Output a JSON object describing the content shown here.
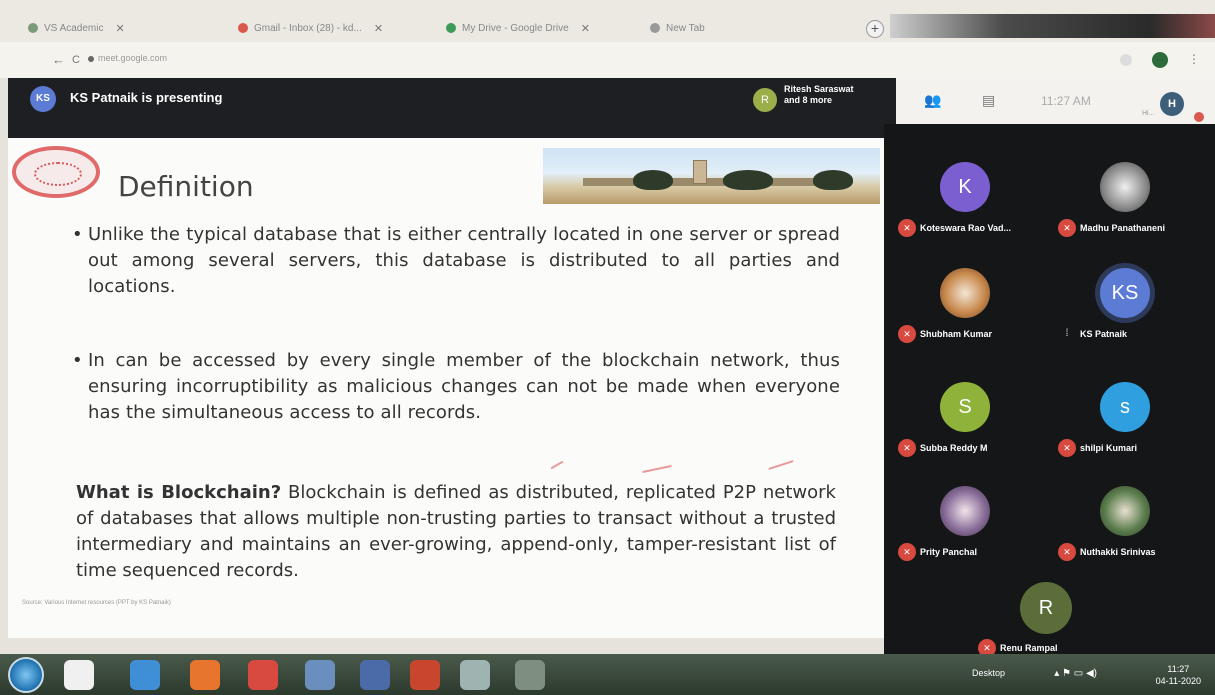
{
  "browser": {
    "tabs": [
      {
        "label": "VS Academic"
      },
      {
        "label": "Gmail - Inbox (28) - kd..."
      },
      {
        "label": "My Drive - Google Drive"
      },
      {
        "label": "New Tab"
      }
    ],
    "new_tab_label": "+",
    "url": "meet.google.com",
    "back": "←",
    "forward": "→",
    "reload": "C",
    "menu_icon": "⋮"
  },
  "meet": {
    "presenter_initials": "KS",
    "presenting_text": "KS Patnaik is presenting",
    "viewer_initial": "R",
    "viewers_text_line1": "Ritesh Saraswat",
    "viewers_text_line2": "and 8 more",
    "time": "11:27 AM",
    "user_initial": "H",
    "user_sub": "Hi..."
  },
  "slide": {
    "title": "Definition",
    "bullet1": "Unlike the typical database that is either centrally located in one server or spread out among several servers, this database is distributed to all parties and  locations.",
    "bullet2": "In can be accessed by every single member of the blockchain network, thus ensuring incorruptibility as malicious changes can not be made when everyone has the simultaneous access  to all records.",
    "para_bold": "What is Blockchain?",
    "para_rest": " Blockchain is defined as distributed, replicated P2P network of databases that allows multiple non-trusting parties to transact without a trusted intermediary and maintains an ever-growing, append-only, tamper-resistant list of time sequenced records.",
    "footnote": "Source: Various Internet resources (PPT by KS Patnaik)"
  },
  "participants": [
    {
      "initial": "K",
      "name": "Koteswara Rao Vad...",
      "color": "#7b5fd1"
    },
    {
      "initial": "",
      "name": "Madhu Panathaneni",
      "color": "#c8c8c8"
    },
    {
      "initial": "",
      "name": "Shubham Kumar",
      "color": "#c98a4e"
    },
    {
      "initial": "KS",
      "name": "KS Patnaik",
      "color": "#5b7bd5"
    },
    {
      "initial": "S",
      "name": "Subba Reddy M",
      "color": "#8fb33a"
    },
    {
      "initial": "s",
      "name": "shilpi Kumari",
      "color": "#2f9fe0"
    },
    {
      "initial": "",
      "name": "Prity Panchal",
      "color": "#8a6f9a"
    },
    {
      "initial": "",
      "name": "Nuthakki Srinivas",
      "color": "#5d7f4f"
    },
    {
      "initial": "R",
      "name": "Renu Rampal",
      "color": "#5b6e3a"
    }
  ],
  "taskbar": {
    "desktop_label": "Desktop",
    "time": "11:27",
    "date": "04-11-2020"
  },
  "colors": {
    "meet_dark": "#1d1f22",
    "mic_off_red": "#d84a3f",
    "slide_bg": "#fbfbfa"
  }
}
